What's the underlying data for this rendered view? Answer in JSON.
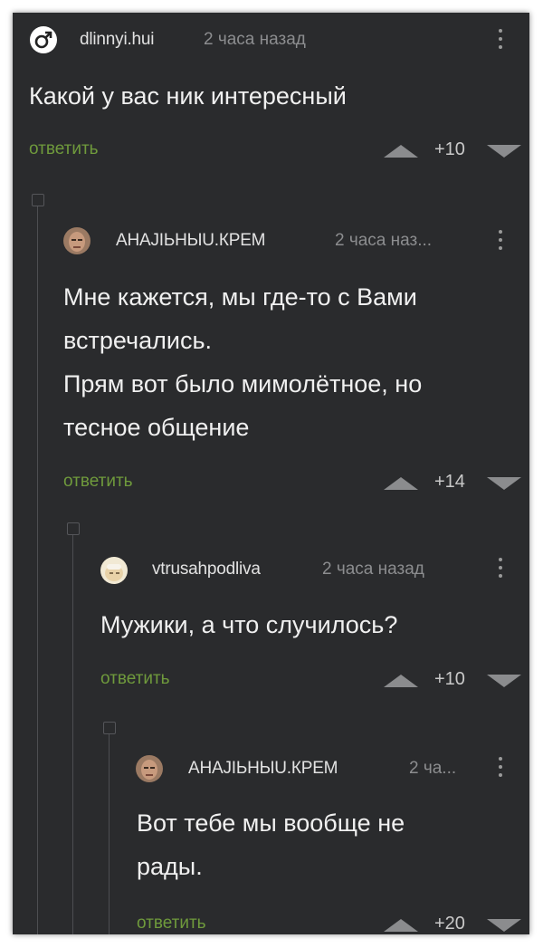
{
  "comments": [
    {
      "username": "dlinnyi.hui",
      "time": "2 часа назад",
      "lines": [
        "Какой у вас ник интересный"
      ],
      "reply_label": "ответить",
      "rating": "+10",
      "avatar_icon": "male-symbol-icon"
    },
    {
      "username": "АНАJIЬНЫU.КРЕМ",
      "time": "2 часа наз...",
      "lines": [
        "Мне кажется, мы где-то с Вами",
        "встречались.",
        "Прям вот было мимолётное, но",
        "тесное общение"
      ],
      "reply_label": "ответить",
      "rating": "+14",
      "avatar_icon": "face-avatar"
    },
    {
      "username": "vtrusahpodliva",
      "time": "2 часа назад",
      "lines": [
        "Мужики, а что случилось?"
      ],
      "reply_label": "ответить",
      "rating": "+10",
      "avatar_icon": "face-avatar"
    },
    {
      "username": "АНАJIЬНЫU.КРЕМ",
      "time": "2 ча...",
      "lines": [
        "Вот тебе мы вообще не",
        "рады."
      ],
      "reply_label": "ответить",
      "rating": "+20",
      "avatar_icon": "face-avatar"
    }
  ],
  "colors": {
    "background": "#2a2b2d",
    "reply_link": "#6f9a3c",
    "text": "#f0f0f0",
    "muted": "#8c8d8f"
  }
}
